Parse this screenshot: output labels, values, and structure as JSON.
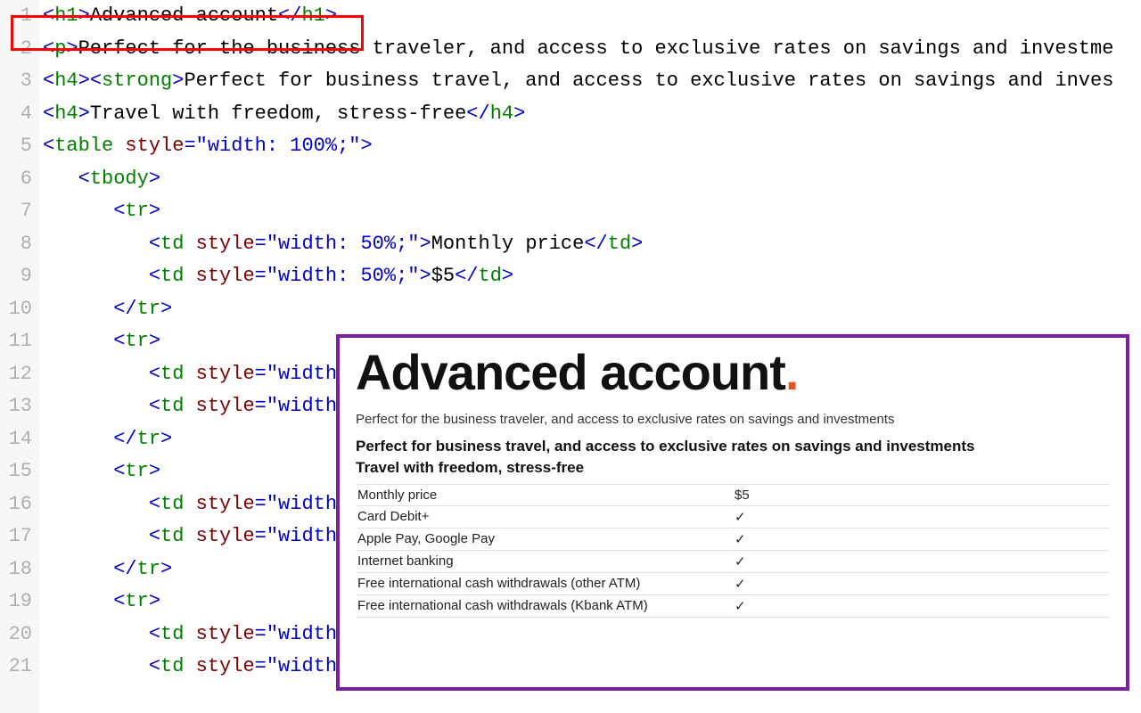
{
  "editor": {
    "lines": [
      {
        "num": "1",
        "indent": 0,
        "parts": [
          {
            "cls": "t-punct",
            "t": "<"
          },
          {
            "cls": "t-tag",
            "t": "h1"
          },
          {
            "cls": "t-punct",
            "t": ">"
          },
          {
            "cls": "t-text",
            "t": "Advanced account"
          },
          {
            "cls": "t-punct",
            "t": "</"
          },
          {
            "cls": "t-tag",
            "t": "h1"
          },
          {
            "cls": "t-punct",
            "t": ">"
          }
        ]
      },
      {
        "num": "2",
        "indent": 0,
        "parts": [
          {
            "cls": "t-punct",
            "t": "<"
          },
          {
            "cls": "t-tag",
            "t": "p"
          },
          {
            "cls": "t-punct",
            "t": ">"
          },
          {
            "cls": "t-text",
            "t": "Perfect for the business traveler, and access to exclusive rates on savings and investme"
          }
        ]
      },
      {
        "num": "3",
        "indent": 0,
        "parts": [
          {
            "cls": "t-punct",
            "t": "<"
          },
          {
            "cls": "t-tag",
            "t": "h4"
          },
          {
            "cls": "t-punct",
            "t": ">"
          },
          {
            "cls": "t-punct",
            "t": "<"
          },
          {
            "cls": "t-tag",
            "t": "strong"
          },
          {
            "cls": "t-punct",
            "t": ">"
          },
          {
            "cls": "t-text",
            "t": "Perfect for business travel, and access to exclusive rates on savings and inves"
          }
        ]
      },
      {
        "num": "4",
        "indent": 0,
        "parts": [
          {
            "cls": "t-punct",
            "t": "<"
          },
          {
            "cls": "t-tag",
            "t": "h4"
          },
          {
            "cls": "t-punct",
            "t": ">"
          },
          {
            "cls": "t-text",
            "t": "Travel with freedom, stress-free"
          },
          {
            "cls": "t-punct",
            "t": "</"
          },
          {
            "cls": "t-tag",
            "t": "h4"
          },
          {
            "cls": "t-punct",
            "t": ">"
          }
        ]
      },
      {
        "num": "5",
        "indent": 0,
        "parts": [
          {
            "cls": "t-punct",
            "t": "<"
          },
          {
            "cls": "t-tag",
            "t": "table"
          },
          {
            "cls": "t-text",
            "t": " "
          },
          {
            "cls": "t-attr",
            "t": "style"
          },
          {
            "cls": "t-punct",
            "t": "="
          },
          {
            "cls": "t-str",
            "t": "\"width: 100%;\""
          },
          {
            "cls": "t-punct",
            "t": ">"
          }
        ]
      },
      {
        "num": "6",
        "indent": 1,
        "parts": [
          {
            "cls": "t-punct",
            "t": "<"
          },
          {
            "cls": "t-tag",
            "t": "tbody"
          },
          {
            "cls": "t-punct",
            "t": ">"
          }
        ]
      },
      {
        "num": "7",
        "indent": 2,
        "parts": [
          {
            "cls": "t-punct",
            "t": "<"
          },
          {
            "cls": "t-tag",
            "t": "tr"
          },
          {
            "cls": "t-punct",
            "t": ">"
          }
        ]
      },
      {
        "num": "8",
        "indent": 3,
        "parts": [
          {
            "cls": "t-punct",
            "t": "<"
          },
          {
            "cls": "t-tag",
            "t": "td"
          },
          {
            "cls": "t-text",
            "t": " "
          },
          {
            "cls": "t-attr",
            "t": "style"
          },
          {
            "cls": "t-punct",
            "t": "="
          },
          {
            "cls": "t-str",
            "t": "\"width: 50%;\""
          },
          {
            "cls": "t-punct",
            "t": ">"
          },
          {
            "cls": "t-text",
            "t": "Monthly price"
          },
          {
            "cls": "t-punct",
            "t": "</"
          },
          {
            "cls": "t-tag",
            "t": "td"
          },
          {
            "cls": "t-punct",
            "t": ">"
          }
        ]
      },
      {
        "num": "9",
        "indent": 3,
        "parts": [
          {
            "cls": "t-punct",
            "t": "<"
          },
          {
            "cls": "t-tag",
            "t": "td"
          },
          {
            "cls": "t-text",
            "t": " "
          },
          {
            "cls": "t-attr",
            "t": "style"
          },
          {
            "cls": "t-punct",
            "t": "="
          },
          {
            "cls": "t-str",
            "t": "\"width: 50%;\""
          },
          {
            "cls": "t-punct",
            "t": ">"
          },
          {
            "cls": "t-text",
            "t": "$5"
          },
          {
            "cls": "t-punct",
            "t": "</"
          },
          {
            "cls": "t-tag",
            "t": "td"
          },
          {
            "cls": "t-punct",
            "t": ">"
          }
        ]
      },
      {
        "num": "10",
        "indent": 2,
        "parts": [
          {
            "cls": "t-punct",
            "t": "</"
          },
          {
            "cls": "t-tag",
            "t": "tr"
          },
          {
            "cls": "t-punct",
            "t": ">"
          }
        ]
      },
      {
        "num": "11",
        "indent": 2,
        "parts": [
          {
            "cls": "t-punct",
            "t": "<"
          },
          {
            "cls": "t-tag",
            "t": "tr"
          },
          {
            "cls": "t-punct",
            "t": ">"
          }
        ]
      },
      {
        "num": "12",
        "indent": 3,
        "parts": [
          {
            "cls": "t-punct",
            "t": "<"
          },
          {
            "cls": "t-tag",
            "t": "td"
          },
          {
            "cls": "t-text",
            "t": " "
          },
          {
            "cls": "t-attr",
            "t": "style"
          },
          {
            "cls": "t-punct",
            "t": "="
          },
          {
            "cls": "t-str",
            "t": "\"width:"
          }
        ]
      },
      {
        "num": "13",
        "indent": 3,
        "parts": [
          {
            "cls": "t-punct",
            "t": "<"
          },
          {
            "cls": "t-tag",
            "t": "td"
          },
          {
            "cls": "t-text",
            "t": " "
          },
          {
            "cls": "t-attr",
            "t": "style"
          },
          {
            "cls": "t-punct",
            "t": "="
          },
          {
            "cls": "t-str",
            "t": "\"width:"
          }
        ]
      },
      {
        "num": "14",
        "indent": 2,
        "parts": [
          {
            "cls": "t-punct",
            "t": "</"
          },
          {
            "cls": "t-tag",
            "t": "tr"
          },
          {
            "cls": "t-punct",
            "t": ">"
          }
        ]
      },
      {
        "num": "15",
        "indent": 2,
        "parts": [
          {
            "cls": "t-punct",
            "t": "<"
          },
          {
            "cls": "t-tag",
            "t": "tr"
          },
          {
            "cls": "t-punct",
            "t": ">"
          }
        ]
      },
      {
        "num": "16",
        "indent": 3,
        "parts": [
          {
            "cls": "t-punct",
            "t": "<"
          },
          {
            "cls": "t-tag",
            "t": "td"
          },
          {
            "cls": "t-text",
            "t": " "
          },
          {
            "cls": "t-attr",
            "t": "style"
          },
          {
            "cls": "t-punct",
            "t": "="
          },
          {
            "cls": "t-str",
            "t": "\"width:"
          }
        ]
      },
      {
        "num": "17",
        "indent": 3,
        "parts": [
          {
            "cls": "t-punct",
            "t": "<"
          },
          {
            "cls": "t-tag",
            "t": "td"
          },
          {
            "cls": "t-text",
            "t": " "
          },
          {
            "cls": "t-attr",
            "t": "style"
          },
          {
            "cls": "t-punct",
            "t": "="
          },
          {
            "cls": "t-str",
            "t": "\"width:"
          }
        ]
      },
      {
        "num": "18",
        "indent": 2,
        "parts": [
          {
            "cls": "t-punct",
            "t": "</"
          },
          {
            "cls": "t-tag",
            "t": "tr"
          },
          {
            "cls": "t-punct",
            "t": ">"
          }
        ]
      },
      {
        "num": "19",
        "indent": 2,
        "parts": [
          {
            "cls": "t-punct",
            "t": "<"
          },
          {
            "cls": "t-tag",
            "t": "tr"
          },
          {
            "cls": "t-punct",
            "t": ">"
          }
        ]
      },
      {
        "num": "20",
        "indent": 3,
        "parts": [
          {
            "cls": "t-punct",
            "t": "<"
          },
          {
            "cls": "t-tag",
            "t": "td"
          },
          {
            "cls": "t-text",
            "t": " "
          },
          {
            "cls": "t-attr",
            "t": "style"
          },
          {
            "cls": "t-punct",
            "t": "="
          },
          {
            "cls": "t-str",
            "t": "\"width:"
          }
        ]
      },
      {
        "num": "21",
        "indent": 3,
        "parts": [
          {
            "cls": "t-punct",
            "t": "<"
          },
          {
            "cls": "t-tag",
            "t": "td"
          },
          {
            "cls": "t-text",
            "t": " "
          },
          {
            "cls": "t-attr",
            "t": "style"
          },
          {
            "cls": "t-punct",
            "t": "="
          },
          {
            "cls": "t-str",
            "t": "\"width:"
          }
        ]
      }
    ]
  },
  "preview": {
    "heading": "Advanced account",
    "lead": "Perfect for the business traveler, and access to exclusive rates on savings and investments",
    "sub1": "Perfect for business travel, and access to exclusive rates on savings and investments",
    "sub2": "Travel with freedom, stress-free",
    "rows": [
      {
        "label": "Monthly price",
        "value": "$5"
      },
      {
        "label": "Card Debit+",
        "value": "✓"
      },
      {
        "label": "Apple Pay, Google Pay",
        "value": "✓"
      },
      {
        "label": "Internet banking",
        "value": "✓"
      },
      {
        "label": "Free international cash withdrawals (other ATM)",
        "value": "✓"
      },
      {
        "label": "Free international cash withdrawals (Kbank ATM)",
        "value": "✓"
      }
    ]
  }
}
